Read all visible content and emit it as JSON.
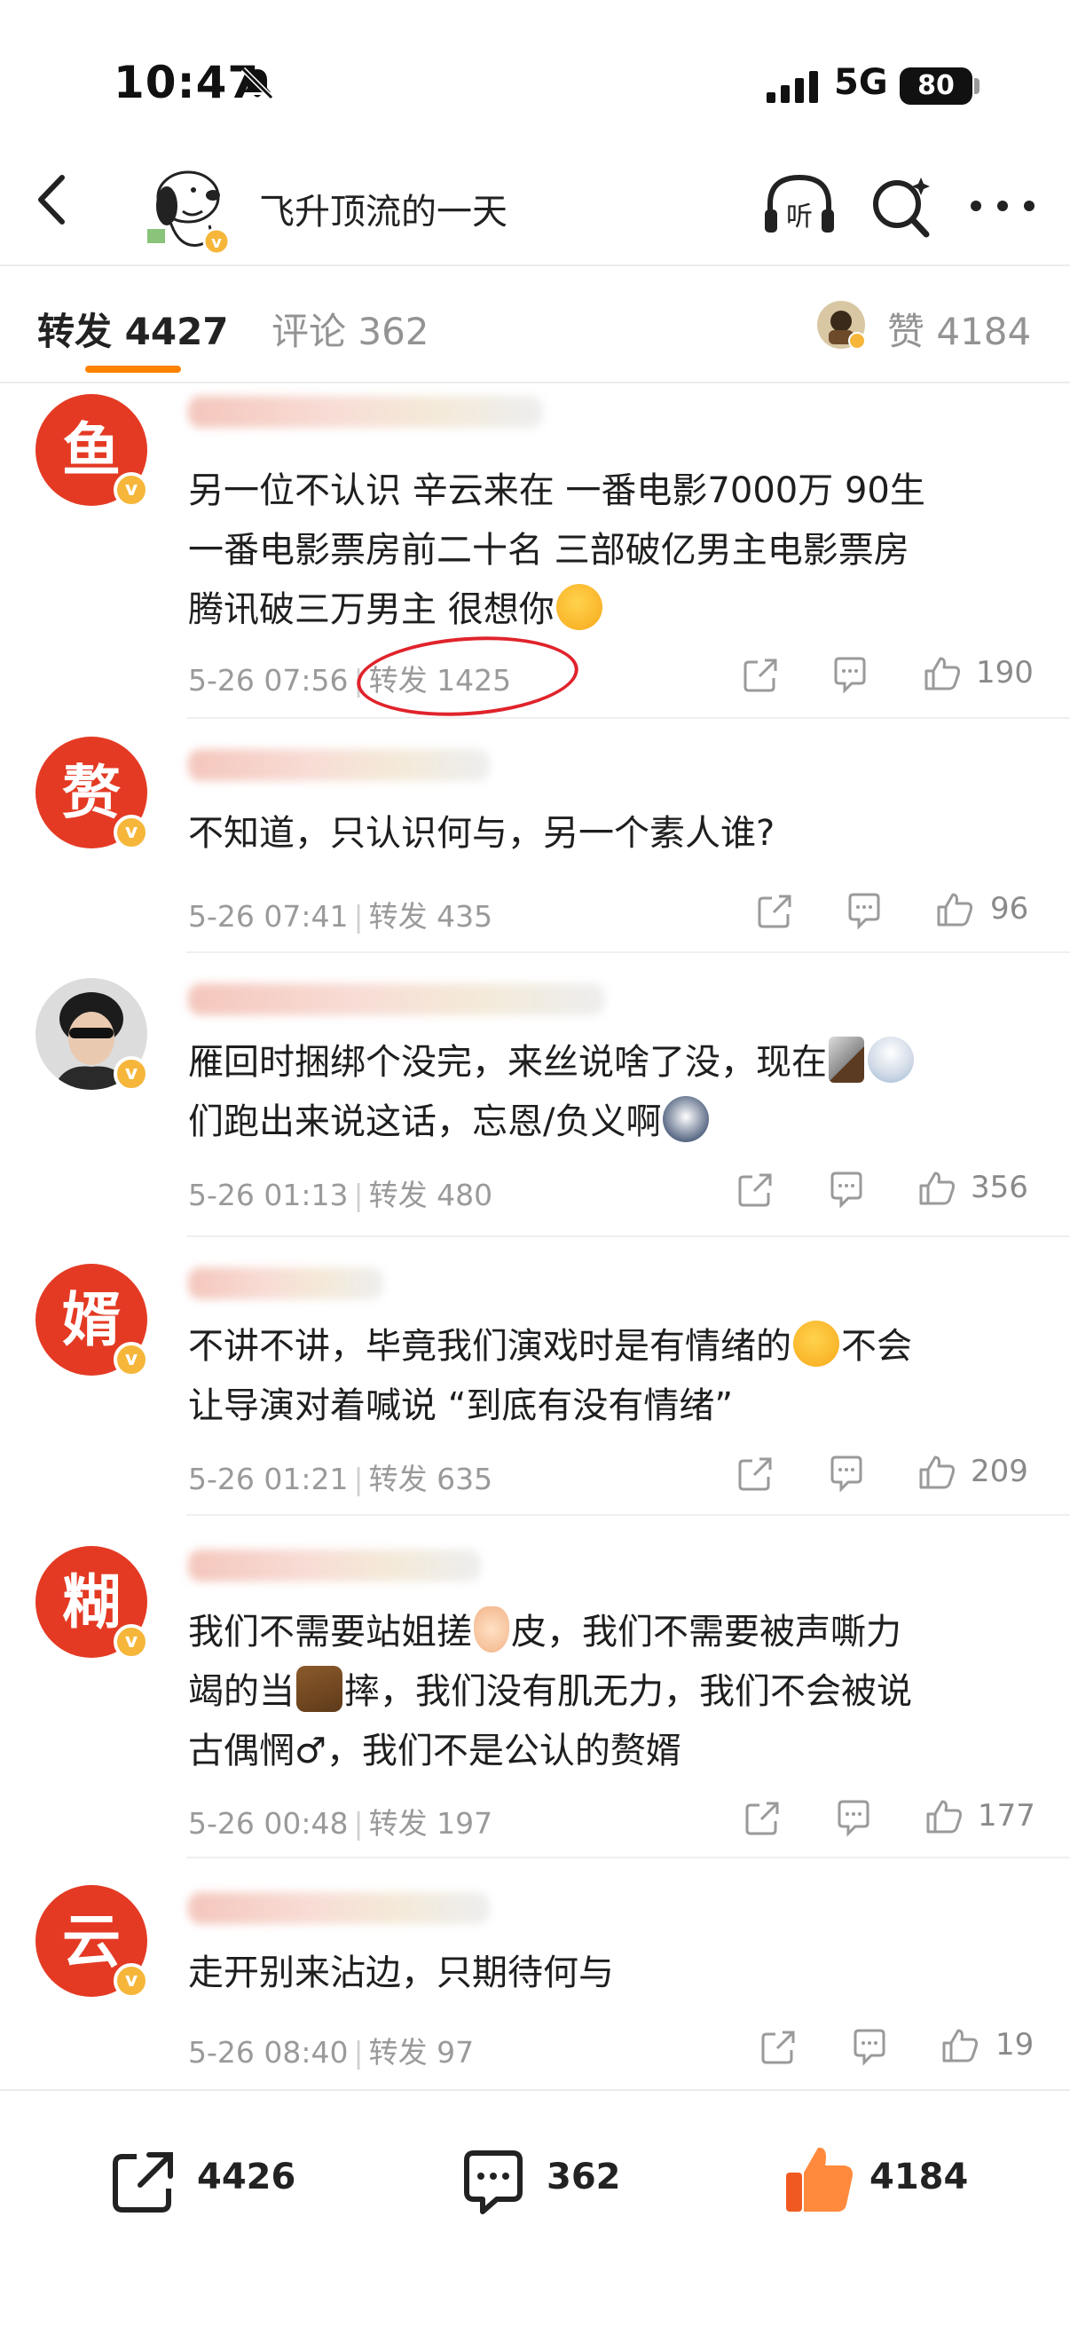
{
  "status_bar": {
    "time": "10:47",
    "network": "5G",
    "battery": "80"
  },
  "header": {
    "title": "飞升顶流的一天",
    "listen_icon_label": "听"
  },
  "tabs": {
    "repost": "转发 4427",
    "comments": "评论 362",
    "likes": "赞 4184"
  },
  "comments": [
    {
      "avatar_char": "鱼",
      "lines": [
        "另一位不认识 辛云来在 一番电影7000万 90生",
        "一番电影票房前二十名 三部破亿男主电影票房",
        "腾讯破三万男主 很想你"
      ],
      "time": "5-26 07:56",
      "reposts": "转发 1425",
      "likes": "190"
    },
    {
      "avatar_char": "赘",
      "lines": [
        "不知道，只认识何与，另一个素人谁?"
      ],
      "time": "5-26 07:41",
      "reposts": "转发 435",
      "likes": "96"
    },
    {
      "avatar_char": "",
      "lines": [
        "雁回时捆绑个没完，来丝说啥了没，现在",
        "们跑出来说这话，忘恩/负义啊"
      ],
      "time": "5-26 01:13",
      "reposts": "转发 480",
      "likes": "356"
    },
    {
      "avatar_char": "婿",
      "lines": [
        "不讲不讲，毕竟我们演戏时是有情绪的",
        "不会",
        "让导演对着喊说 “到底有没有情绪”"
      ],
      "time": "5-26 01:21",
      "reposts": "转发 635",
      "likes": "209"
    },
    {
      "avatar_char": "糊",
      "lines": [
        "我们不需要站姐搓",
        "皮，我们不需要被声嘶力",
        "竭的当",
        "摔，我们没有肌无力，我们不会被说",
        "古偶惘♂，我们不是公认的赘婿"
      ],
      "time": "5-26 00:48",
      "reposts": "转发 197",
      "likes": "177"
    },
    {
      "avatar_char": "云",
      "lines": [
        "走开别来沾边，只期待何与"
      ],
      "time": "5-26 08:40",
      "reposts": "转发 97",
      "likes": "19"
    }
  ],
  "bottom_bar": {
    "reposts": "4426",
    "comments": "362",
    "likes": "4184"
  },
  "colors": {
    "accent": "#ff8200",
    "avatar_red": "#e43a24",
    "verified_badge": "#f6b63a",
    "meta_gray": "#9a9a9a",
    "annotation_red": "#e0232b"
  }
}
